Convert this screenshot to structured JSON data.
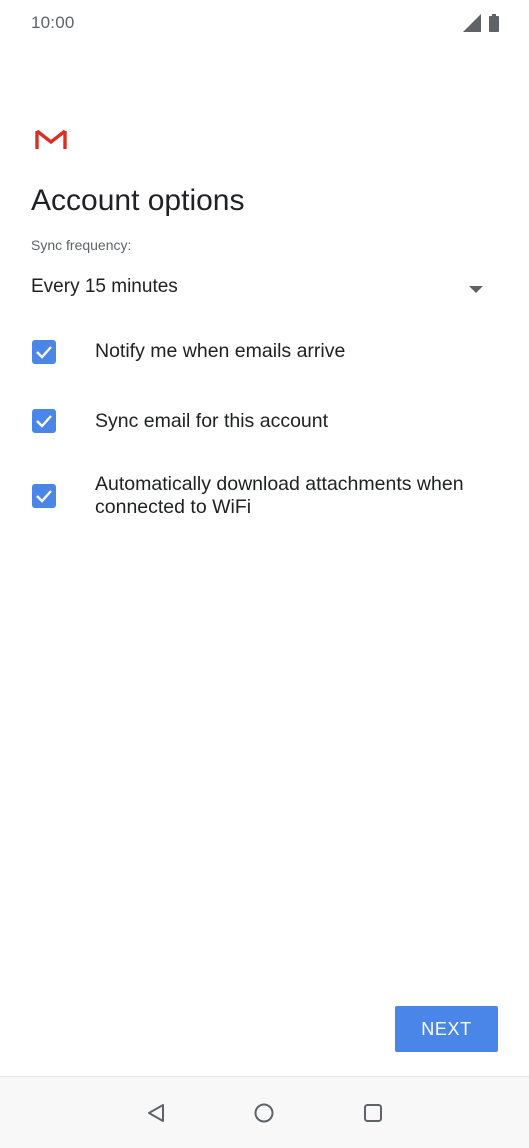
{
  "status_bar": {
    "time": "10:00",
    "icons": [
      "signal-icon",
      "battery-icon"
    ]
  },
  "app": {
    "logo": "gmail-logo",
    "title": "Account options"
  },
  "sync": {
    "label": "Sync frequency:",
    "selected": "Every 15 minutes"
  },
  "options": [
    {
      "label": "Notify me when emails arrive",
      "checked": true
    },
    {
      "label": "Sync email for this account",
      "checked": true
    },
    {
      "label": "Automatically download attachments when connected to WiFi",
      "checked": true
    }
  ],
  "actions": {
    "next_label": "NEXT"
  },
  "nav": {
    "icons": [
      "back-icon",
      "home-icon",
      "recents-icon"
    ]
  },
  "colors": {
    "accent": "#4a86e8",
    "gmail_red": "#d93025",
    "text_primary": "#202124",
    "text_secondary": "#5f6368"
  }
}
